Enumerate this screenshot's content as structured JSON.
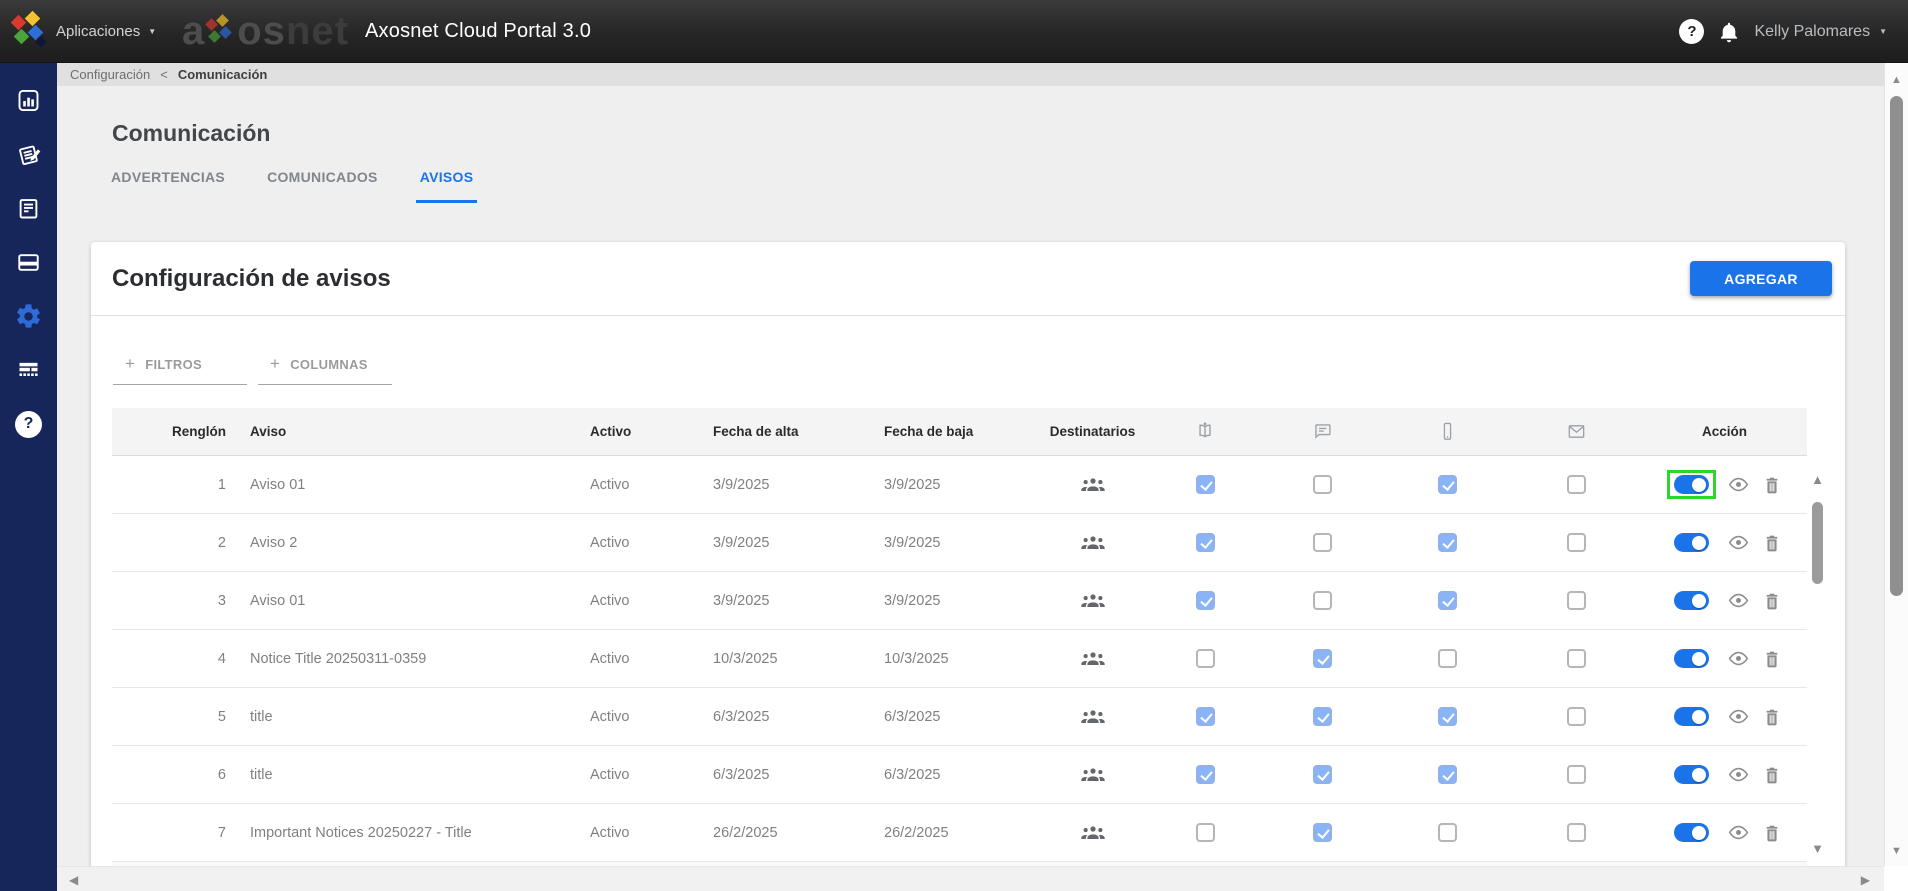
{
  "colors": {
    "accent_blue": "#1a73e8",
    "sidebar_navy": "#16265a",
    "topbar_dark": "#262626",
    "checkbox_checked_blue": "#8ab4f8",
    "highlight_green": "#2fd42f",
    "breadcrumb_gray": "#e0e0e0"
  },
  "icons": {
    "help_glyph": "?",
    "plus_glyph": "+",
    "caret": "▼",
    "up": "▲",
    "down": "▼",
    "left": "◀",
    "right": "▶"
  },
  "topbar": {
    "apps_menu": "Aplicaciones",
    "watermark_prefix": "a",
    "watermark_mid": "os",
    "watermark_suffix": "net",
    "title": "Axosnet Cloud Portal 3.0",
    "user_name": "Kelly Palomares"
  },
  "breadcrumb": {
    "parent": "Configuración",
    "separator": "<",
    "current": "Comunicación"
  },
  "sidebar": {
    "items": [
      "dashboard",
      "notes",
      "documents",
      "payments",
      "settings",
      "data-table",
      "help"
    ],
    "active_item": "settings"
  },
  "page": {
    "title": "Comunicación",
    "tabs": [
      {
        "label": "ADVERTENCIAS",
        "active": false
      },
      {
        "label": "COMUNICADOS",
        "active": false
      },
      {
        "label": "AVISOS",
        "active": true
      }
    ]
  },
  "card": {
    "title": "Configuración de avisos",
    "add_button": "AGREGAR",
    "filters": "FILTROS",
    "columns": "COLUMNAS"
  },
  "table": {
    "headers": {
      "renglon": "Renglón",
      "aviso": "Aviso",
      "activo": "Activo",
      "fecha_alta": "Fecha de alta",
      "fecha_baja": "Fecha de baja",
      "destinatarios": "Destinatarios",
      "accion": "Acción"
    },
    "channel_columns": [
      "portal-icon",
      "chat-icon",
      "mobile-icon",
      "email-icon"
    ],
    "rows": [
      {
        "renglon": 1,
        "aviso": "Aviso 01",
        "activo": "Activo",
        "fecha_alta": "3/9/2025",
        "fecha_baja": "3/9/2025",
        "channels": [
          true,
          false,
          true,
          false
        ],
        "toggle": true,
        "highlighted": true
      },
      {
        "renglon": 2,
        "aviso": "Aviso 2",
        "activo": "Activo",
        "fecha_alta": "3/9/2025",
        "fecha_baja": "3/9/2025",
        "channels": [
          true,
          false,
          true,
          false
        ],
        "toggle": true,
        "highlighted": false
      },
      {
        "renglon": 3,
        "aviso": "Aviso 01",
        "activo": "Activo",
        "fecha_alta": "3/9/2025",
        "fecha_baja": "3/9/2025",
        "channels": [
          true,
          false,
          true,
          false
        ],
        "toggle": true,
        "highlighted": false
      },
      {
        "renglon": 4,
        "aviso": "Notice Title 20250311-0359",
        "activo": "Activo",
        "fecha_alta": "10/3/2025",
        "fecha_baja": "10/3/2025",
        "channels": [
          false,
          true,
          false,
          false
        ],
        "toggle": true,
        "highlighted": false
      },
      {
        "renglon": 5,
        "aviso": "title",
        "activo": "Activo",
        "fecha_alta": "6/3/2025",
        "fecha_baja": "6/3/2025",
        "channels": [
          true,
          true,
          true,
          false
        ],
        "toggle": true,
        "highlighted": false
      },
      {
        "renglon": 6,
        "aviso": "title",
        "activo": "Activo",
        "fecha_alta": "6/3/2025",
        "fecha_baja": "6/3/2025",
        "channels": [
          true,
          true,
          true,
          false
        ],
        "toggle": true,
        "highlighted": false
      },
      {
        "renglon": 7,
        "aviso": "Important Notices 20250227 - Title",
        "activo": "Activo",
        "fecha_alta": "26/2/2025",
        "fecha_baja": "26/2/2025",
        "channels": [
          false,
          true,
          false,
          false
        ],
        "toggle": true,
        "highlighted": false
      }
    ]
  }
}
